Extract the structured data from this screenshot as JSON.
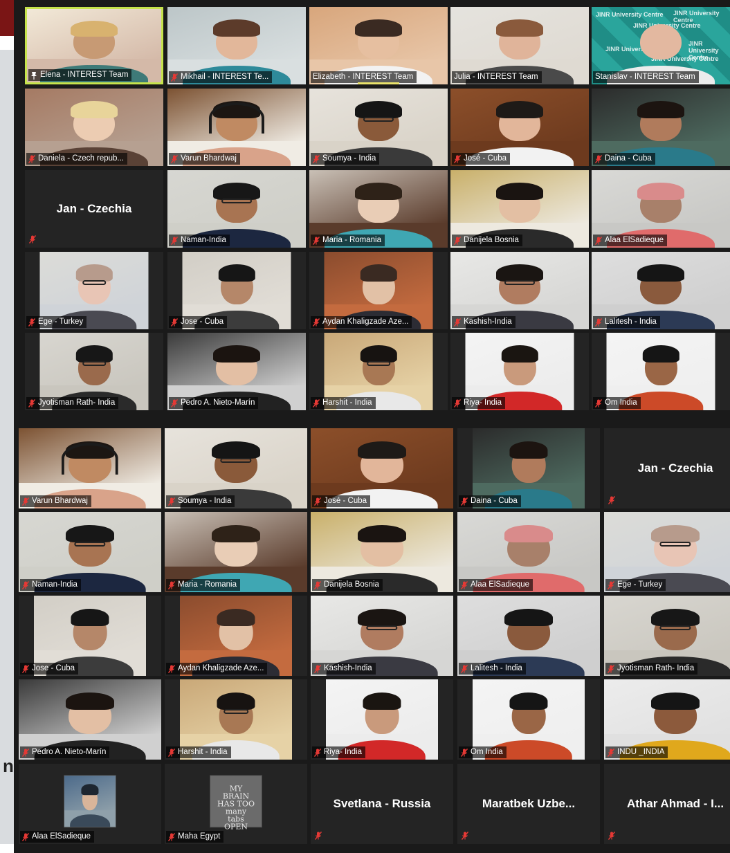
{
  "meeting": {
    "gallery_top": [
      {
        "name": "Elena - INTEREST Team",
        "pinned": true,
        "active": true,
        "mic": "on",
        "palette": [
          "#f2e9d8",
          "#d4b9a8",
          "#c79a74",
          "#d8b26f",
          "#3e7a78"
        ]
      },
      {
        "name": "Mikhail - INTEREST Te...",
        "mic": "muted",
        "palette": [
          "#bcc6c8",
          "#d9dfe0",
          "#e2b79a",
          "#5c3b2a",
          "#2e8a9a"
        ]
      },
      {
        "name": "Elizabeth - INTEREST Team",
        "mic": "on",
        "speaking": true,
        "palette": [
          "#d8a67c",
          "#e8c6a8",
          "#e6bfa0",
          "#3a2a22",
          "#f2f2f2"
        ]
      },
      {
        "name": "Julia - INTEREST Team",
        "mic": "on",
        "palette": [
          "#e5e3de",
          "#dfdad2",
          "#e0b49a",
          "#8a5a3c",
          "#4a4a4a"
        ]
      },
      {
        "name": "Stanislav - INTEREST Team",
        "mic": "on",
        "logo_bg": true,
        "logo_text": "JINR University Centre",
        "palette": [
          "#1f8d86",
          "#2aa59c",
          "#e3b8a0",
          "#d9d9d9",
          "#ececec"
        ]
      },
      {
        "name": "Daniela - Czech repub...",
        "mic": "muted",
        "palette": [
          "#a57a63",
          "#b6a091",
          "#ecccb2",
          "#e8d49a",
          "#5a4236"
        ]
      },
      {
        "name": "Varun Bhardwaj",
        "mic": "muted",
        "headset": true,
        "palette": [
          "#7c5232",
          "#f0ece4",
          "#c08a62",
          "#1c1612",
          "#d9a38a"
        ]
      },
      {
        "name": "Soumya - India",
        "mic": "muted",
        "glasses": true,
        "palette": [
          "#e7e3dc",
          "#d9d3c8",
          "#8a5a3a",
          "#151515",
          "#3a3a3a"
        ]
      },
      {
        "name": "José - Cuba",
        "mic": "muted",
        "palette": [
          "#8c4f2a",
          "#6d3a1e",
          "#e2b69a",
          "#1e1a17",
          "#f2f2f2"
        ]
      },
      {
        "name": "Daina - Cuba",
        "mic": "muted",
        "palette": [
          "#2b2b2b",
          "#4e6b60",
          "#b07b5c",
          "#1c1410",
          "#2a7a8a"
        ]
      },
      {
        "name": "Jan - Czechia",
        "mic": "muted",
        "no_video": true
      },
      {
        "name": "Naman-India",
        "mic": "muted",
        "glasses": true,
        "palette": [
          "#d7d7d2",
          "#cfcfc8",
          "#a87452",
          "#171717",
          "#1c2740"
        ]
      },
      {
        "name": "Maria - Romania",
        "mic": "muted",
        "palette": [
          "#c9c0b6",
          "#5a3b2b",
          "#e9cdb6",
          "#2e2218",
          "#3fa7b3"
        ]
      },
      {
        "name": "Danijela Bosnia",
        "mic": "muted",
        "palette": [
          "#c9b06a",
          "#ede9df",
          "#e3bfa3",
          "#1a1411",
          "#2a2a2a"
        ]
      },
      {
        "name": "Alaa ElSadieque",
        "mic": "muted",
        "palette": [
          "#d9d9d6",
          "#c8c8c5",
          "#a8806a",
          "#d98b8b",
          "#e06b6b"
        ]
      },
      {
        "name": "Ege - Turkey",
        "mic": "muted",
        "glasses": true,
        "framed": true,
        "palette": [
          "#dcdcd8",
          "#cfd3d8",
          "#e8c5b5",
          "#b79b8c",
          "#4a4a52"
        ]
      },
      {
        "name": "Jose - Cuba",
        "mic": "muted",
        "framed": true,
        "palette": [
          "#d2cec6",
          "#e1ddd6",
          "#b58769",
          "#161616",
          "#3c3c3c"
        ]
      },
      {
        "name": "Aydan Khaligzade Aze...",
        "mic": "muted",
        "framed": true,
        "palette": [
          "#8b4c2e",
          "#c46b3f",
          "#e2c1a6",
          "#3a2a22",
          "#2c2c34"
        ]
      },
      {
        "name": "Kashish-India",
        "mic": "muted",
        "glasses": true,
        "palette": [
          "#e8e8e6",
          "#d6d6d4",
          "#b07c60",
          "#1a1512",
          "#3a3a42"
        ]
      },
      {
        "name": "Lalitesh - India",
        "mic": "muted",
        "palette": [
          "#dedede",
          "#cfcfcf",
          "#8a5a3d",
          "#151515",
          "#2c3a55"
        ]
      },
      {
        "name": "Jyotisman Rath- India",
        "mic": "muted",
        "glasses": true,
        "framed": true,
        "palette": [
          "#d8d6d0",
          "#c9c6be",
          "#9a6a4c",
          "#171717",
          "#2a2a2a"
        ]
      },
      {
        "name": "Pedro A. Nieto-Marín",
        "mic": "muted",
        "palette": [
          "#3a3a3a",
          "#d0d0d0",
          "#e3bfa4",
          "#1b1410",
          "#222222"
        ]
      },
      {
        "name": "Harshit - India",
        "mic": "muted",
        "glasses": true,
        "framed": true,
        "palette": [
          "#c9a878",
          "#e6d2a6",
          "#a87854",
          "#171311",
          "#e8e8e8"
        ]
      },
      {
        "name": "Riya- India",
        "mic": "muted",
        "framed": true,
        "palette": [
          "#f4f4f4",
          "#ececec",
          "#c99a7c",
          "#1a1511",
          "#d22828"
        ]
      },
      {
        "name": "Om India",
        "mic": "muted",
        "framed": true,
        "palette": [
          "#f4f4f4",
          "#efefef",
          "#9a6646",
          "#151515",
          "#cc4a28"
        ]
      }
    ],
    "gallery_bottom": [
      {
        "name": "Varun Bhardwaj",
        "mic": "muted",
        "headset": true,
        "palette": [
          "#7c5232",
          "#f0ece4",
          "#c08a62",
          "#1c1612",
          "#d9a38a"
        ]
      },
      {
        "name": "Soumya - India",
        "mic": "muted",
        "glasses": true,
        "palette": [
          "#e7e3dc",
          "#d9d3c8",
          "#8a5a3a",
          "#151515",
          "#3a3a3a"
        ]
      },
      {
        "name": "José - Cuba",
        "mic": "muted",
        "palette": [
          "#8c4f2a",
          "#6d3a1e",
          "#e2b69a",
          "#1e1a17",
          "#f2f2f2"
        ]
      },
      {
        "name": "Daina - Cuba",
        "mic": "muted",
        "framed": true,
        "palette": [
          "#2b2b2b",
          "#4e6b60",
          "#b07b5c",
          "#1c1410",
          "#2a7a8a"
        ]
      },
      {
        "name": "Jan - Czechia",
        "mic": "muted",
        "no_video": true
      },
      {
        "name": "Naman-India",
        "mic": "muted",
        "glasses": true,
        "palette": [
          "#d7d7d2",
          "#cfcfc8",
          "#a87452",
          "#171717",
          "#1c2740"
        ]
      },
      {
        "name": "Maria - Romania",
        "mic": "muted",
        "palette": [
          "#c9c0b6",
          "#5a3b2b",
          "#e9cdb6",
          "#2e2218",
          "#3fa7b3"
        ]
      },
      {
        "name": "Danijela Bosnia",
        "mic": "muted",
        "palette": [
          "#c9b06a",
          "#ede9df",
          "#e3bfa3",
          "#1a1411",
          "#2a2a2a"
        ]
      },
      {
        "name": "Alaa ElSadieque",
        "mic": "muted",
        "palette": [
          "#d9d9d6",
          "#c8c8c5",
          "#a8806a",
          "#d98b8b",
          "#e06b6b"
        ]
      },
      {
        "name": "Ege - Turkey",
        "mic": "muted",
        "glasses": true,
        "palette": [
          "#dcdcd8",
          "#cfd3d8",
          "#e8c5b5",
          "#b79b8c",
          "#4a4a52"
        ]
      },
      {
        "name": "Jose - Cuba",
        "mic": "muted",
        "framed": true,
        "palette": [
          "#d2cec6",
          "#e1ddd6",
          "#b58769",
          "#161616",
          "#3c3c3c"
        ]
      },
      {
        "name": "Aydan Khaligzade Aze...",
        "mic": "muted",
        "framed": true,
        "palette": [
          "#8b4c2e",
          "#c46b3f",
          "#e2c1a6",
          "#3a2a22",
          "#2c2c34"
        ]
      },
      {
        "name": "Kashish-India",
        "mic": "muted",
        "glasses": true,
        "palette": [
          "#e8e8e6",
          "#d6d6d4",
          "#b07c60",
          "#1a1512",
          "#3a3a42"
        ]
      },
      {
        "name": "Lalitesh - India",
        "mic": "muted",
        "palette": [
          "#dedede",
          "#cfcfcf",
          "#8a5a3d",
          "#151515",
          "#2c3a55"
        ]
      },
      {
        "name": "Jyotisman Rath- India",
        "mic": "muted",
        "glasses": true,
        "palette": [
          "#d8d6d0",
          "#c9c6be",
          "#9a6a4c",
          "#171717",
          "#2a2a2a"
        ]
      },
      {
        "name": "Pedro A. Nieto-Marín",
        "mic": "muted",
        "palette": [
          "#3a3a3a",
          "#d0d0d0",
          "#e3bfa4",
          "#1b1410",
          "#222222"
        ]
      },
      {
        "name": "Harshit - India",
        "mic": "muted",
        "glasses": true,
        "framed": true,
        "palette": [
          "#c9a878",
          "#e6d2a6",
          "#a87854",
          "#171311",
          "#e8e8e8"
        ]
      },
      {
        "name": "Riya- India",
        "mic": "muted",
        "framed": true,
        "palette": [
          "#f4f4f4",
          "#ececec",
          "#c99a7c",
          "#1a1511",
          "#d22828"
        ]
      },
      {
        "name": "Om India",
        "mic": "muted",
        "framed": true,
        "palette": [
          "#f4f4f4",
          "#efefef",
          "#9a6646",
          "#151515",
          "#cc4a28"
        ]
      },
      {
        "name": "INDU _INDIA",
        "mic": "muted",
        "palette": [
          "#ececec",
          "#e0e0e0",
          "#8c5a3c",
          "#151515",
          "#e0a81c"
        ]
      },
      {
        "name": "Alaa ElSadieque",
        "mic": "muted",
        "thumb_photo": true,
        "palette": [
          "#4c6a8a",
          "#8fa0aa",
          "#d9b59a",
          "#1e2630",
          "#3a4a5a"
        ]
      },
      {
        "name": "Maha Egypt",
        "mic": "muted",
        "thumb_text": "MY\nBRAIN\nHAS TOO\nmany\ntabs\nOPEN"
      },
      {
        "name": "Svetlana - Russia",
        "mic": "muted",
        "no_video": true
      },
      {
        "name": "Maratbek  Uzbe...",
        "mic": "muted",
        "no_video": true
      },
      {
        "name": "Athar Ahmad - I...",
        "mic": "muted",
        "no_video": true
      }
    ]
  },
  "sidebar": {
    "glyph": "n"
  },
  "colors": {
    "active_border": "#c6e34c",
    "muted_mic": "#e53935",
    "speaking_bar": "#e9e26b"
  }
}
